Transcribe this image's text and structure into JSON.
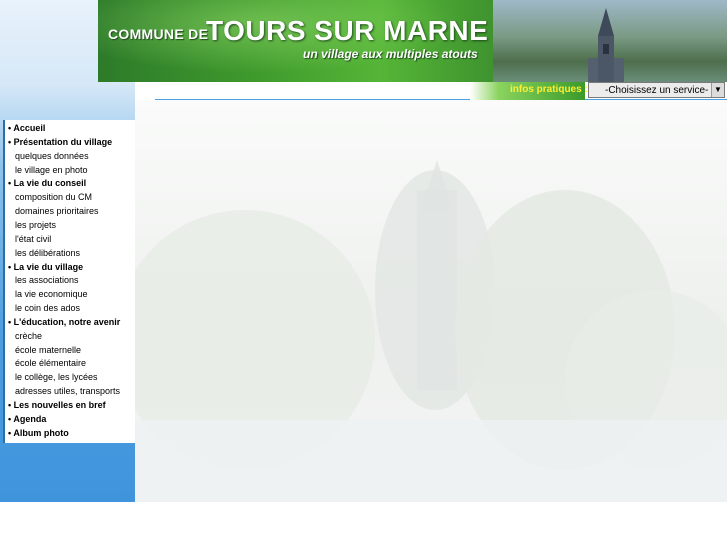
{
  "header": {
    "commune_de": "COMMUNE DE",
    "town_name": "TOURS SUR MARNE",
    "slogan": "un village aux multiples atouts"
  },
  "infobar": {
    "label": "infos pratiques :",
    "select_value": "-Choisissez un service-",
    "dropdown_arrow": "▼"
  },
  "colors": {
    "accent_blue": "#4c9ee0",
    "banner_green": "#3f9a2c",
    "infos_yellow": "#ffee33"
  },
  "menu": {
    "items": [
      {
        "label": "• Accueil",
        "level": "main"
      },
      {
        "label": "• Présentation du village",
        "level": "main"
      },
      {
        "label": "quelques données",
        "level": "sub"
      },
      {
        "label": "le village en photo",
        "level": "sub"
      },
      {
        "label": "• La vie du conseil",
        "level": "main"
      },
      {
        "label": "composition du CM",
        "level": "sub"
      },
      {
        "label": "domaines prioritaires",
        "level": "sub"
      },
      {
        "label": "les projets",
        "level": "sub"
      },
      {
        "label": "l'état civil",
        "level": "sub"
      },
      {
        "label": "les délibérations",
        "level": "sub"
      },
      {
        "label": "• La vie du village",
        "level": "main"
      },
      {
        "label": "les associations",
        "level": "sub"
      },
      {
        "label": "la vie economique",
        "level": "sub"
      },
      {
        "label": "le coin des ados",
        "level": "sub"
      },
      {
        "label": "• L'éducation, notre avenir",
        "level": "main"
      },
      {
        "label": "crèche",
        "level": "sub"
      },
      {
        "label": "école maternelle",
        "level": "sub"
      },
      {
        "label": "école élémentaire",
        "level": "sub"
      },
      {
        "label": "le collège, les lycées",
        "level": "sub"
      },
      {
        "label": "adresses utiles, transports",
        "level": "sub"
      },
      {
        "label": "• Les nouvelles en bref",
        "level": "main"
      },
      {
        "label": "• Agenda",
        "level": "main"
      },
      {
        "label": "• Album photo",
        "level": "main"
      }
    ]
  }
}
